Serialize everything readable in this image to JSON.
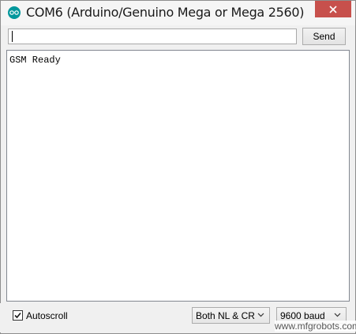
{
  "window": {
    "title": "COM6 (Arduino/Genuino Mega or Mega 2560)",
    "icon": "arduino-logo-icon",
    "close_color": "#c7504c",
    "accent_color": "#00979c"
  },
  "send_row": {
    "input_value": "",
    "send_label": "Send"
  },
  "output": {
    "lines": [
      "GSM Ready"
    ]
  },
  "bottom_bar": {
    "autoscroll_label": "Autoscroll",
    "autoscroll_checked": true,
    "line_ending_selected": "Both NL & CR",
    "baud_selected": "9600 baud"
  },
  "watermark": {
    "text": "www.mfgrobots.com"
  }
}
